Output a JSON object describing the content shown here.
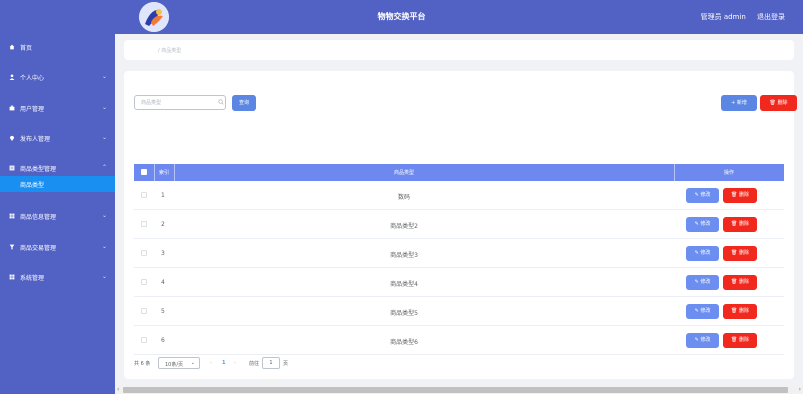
{
  "header": {
    "title": "物物交换平台",
    "user_label": "管理员 admin",
    "logout_label": "退出登录"
  },
  "sidebar": {
    "items": [
      {
        "label": "首页",
        "icon": "home-icon"
      },
      {
        "label": "个人中心",
        "icon": "user-icon"
      },
      {
        "label": "用户管理",
        "icon": "users-icon"
      },
      {
        "label": "发布人管理",
        "icon": "pin-icon"
      },
      {
        "label": "商品类型管理",
        "icon": "list-icon"
      },
      {
        "label": "商品信息管理",
        "icon": "grid-icon"
      },
      {
        "label": "商品交易管理",
        "icon": "filter-icon"
      },
      {
        "label": "系统管理",
        "icon": "grid-icon"
      }
    ],
    "active_sub": "商品类型"
  },
  "breadcrumb": "/ 商品类型",
  "search": {
    "placeholder": "商品类型",
    "query_label": "查询",
    "add_label": "+ 新增",
    "delete_label": "删除"
  },
  "table": {
    "headers": [
      "索引",
      "商品类型",
      "操作"
    ],
    "rows": [
      {
        "index": "1",
        "type": "数码"
      },
      {
        "index": "2",
        "type": "商品类型2"
      },
      {
        "index": "3",
        "type": "商品类型3"
      },
      {
        "index": "4",
        "type": "商品类型4"
      },
      {
        "index": "5",
        "type": "商品类型5"
      },
      {
        "index": "6",
        "type": "商品类型6"
      }
    ],
    "edit_label": "修改",
    "delete_label": "删除"
  },
  "pager": {
    "total": "共 6 条",
    "page_size": "10条/页",
    "current_page": "1",
    "goto_label": "前往",
    "goto_value": "1",
    "goto_unit": "页"
  },
  "colors": {
    "primary": "#5261c4",
    "active": "#1a8ff2",
    "table_header": "#6d89f0",
    "danger": "#f0281e"
  }
}
